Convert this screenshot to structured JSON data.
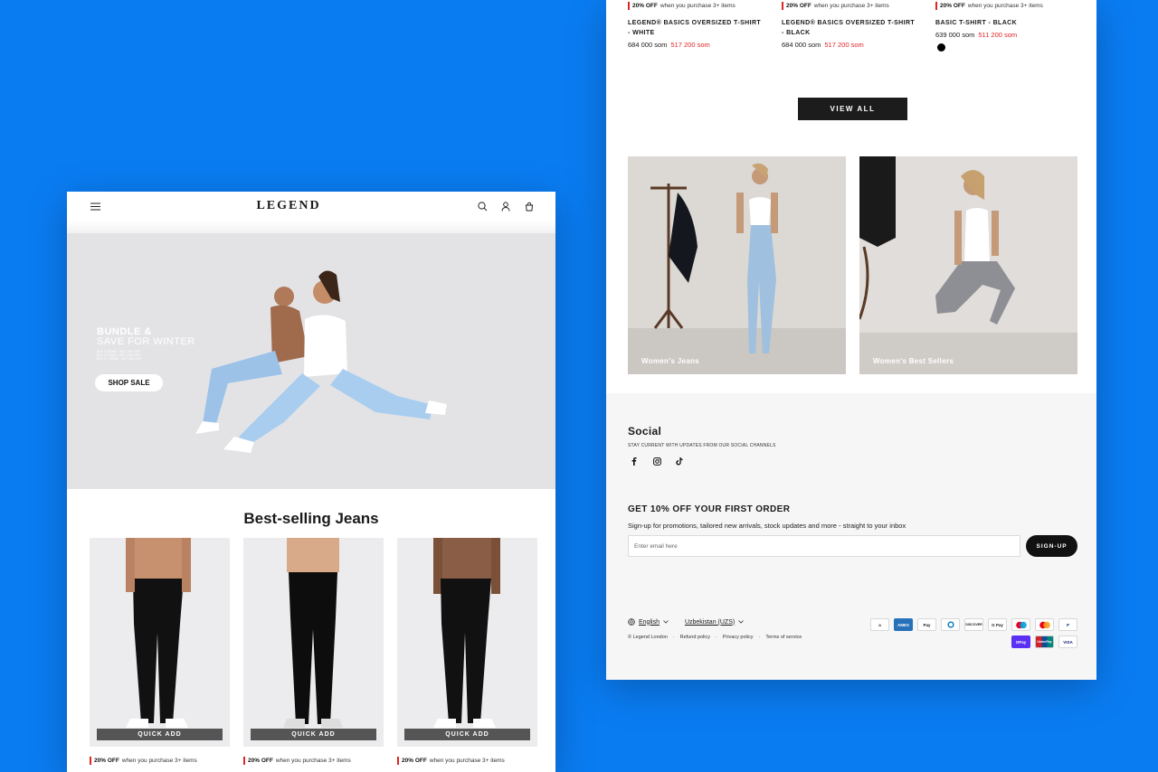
{
  "left": {
    "logo": "LEGEND",
    "hero": {
      "title_line1": "BUNDLE &",
      "title_line2": "SAVE FOR WINTER",
      "fine_print": [
        "BUY 2 ITEMS - GET 15% OFF",
        "BUY 3 ITEMS - GET 20% OFF",
        "BUY 4+ ITEMS - GET 25% OFF"
      ],
      "cta": "SHOP SALE"
    },
    "section_title": "Best-selling Jeans",
    "products": [
      {
        "quick_add": "QUICK ADD",
        "promo_bold": "20% OFF",
        "promo_text": "when you purchase 3+ items"
      },
      {
        "quick_add": "QUICK ADD",
        "promo_bold": "20% OFF",
        "promo_text": "when you purchase 3+ items"
      },
      {
        "quick_add": "QUICK ADD",
        "promo_bold": "20% OFF",
        "promo_text": "when you purchase 3+ items"
      }
    ]
  },
  "right": {
    "products": [
      {
        "promo_bold": "20% OFF",
        "promo_text": "when you purchase 3+ items",
        "name": "LEGEND® BASICS OVERSIZED T-SHIRT - WHITE",
        "price": "684 000 som",
        "compare_price": "517 200 som"
      },
      {
        "promo_bold": "20% OFF",
        "promo_text": "when you purchase 3+ items",
        "name": "LEGEND® BASICS OVERSIZED T-SHIRT - BLACK",
        "price": "684 000 som",
        "compare_price": "517 200 som"
      },
      {
        "promo_bold": "20% OFF",
        "promo_text": "when you purchase 3+ items",
        "name": "BASIC T-SHIRT - BLACK",
        "price": "639 000 som",
        "compare_price": "511 200 som"
      }
    ],
    "view_all": "VIEW ALL",
    "categories": [
      {
        "label": "Women's Jeans"
      },
      {
        "label": "Women's Best Sellers"
      }
    ],
    "footer": {
      "social_title": "Social",
      "social_sub": "STAY CURRENT WITH UPDATES FROM OUR SOCIAL CHANNELS",
      "signup_title": "GET 10% OFF YOUR FIRST ORDER",
      "signup_sub": "Sign-up for promotions, tailored new arrivals, stock updates and more - straight to your inbox",
      "email_placeholder": "Enter email here",
      "signup_button": "SIGN-UP",
      "language": "English",
      "currency": "Uzbekistan (UZS)",
      "copyright": "© Legend London",
      "refund": "Refund policy",
      "privacy": "Privacy policy",
      "terms": "Terms of service",
      "payments": [
        "a",
        "AMEX",
        "Pay",
        "",
        "DISCOVER",
        "G Pay",
        "",
        "",
        "P",
        "OPay",
        "UnionPay",
        "VISA"
      ]
    }
  }
}
